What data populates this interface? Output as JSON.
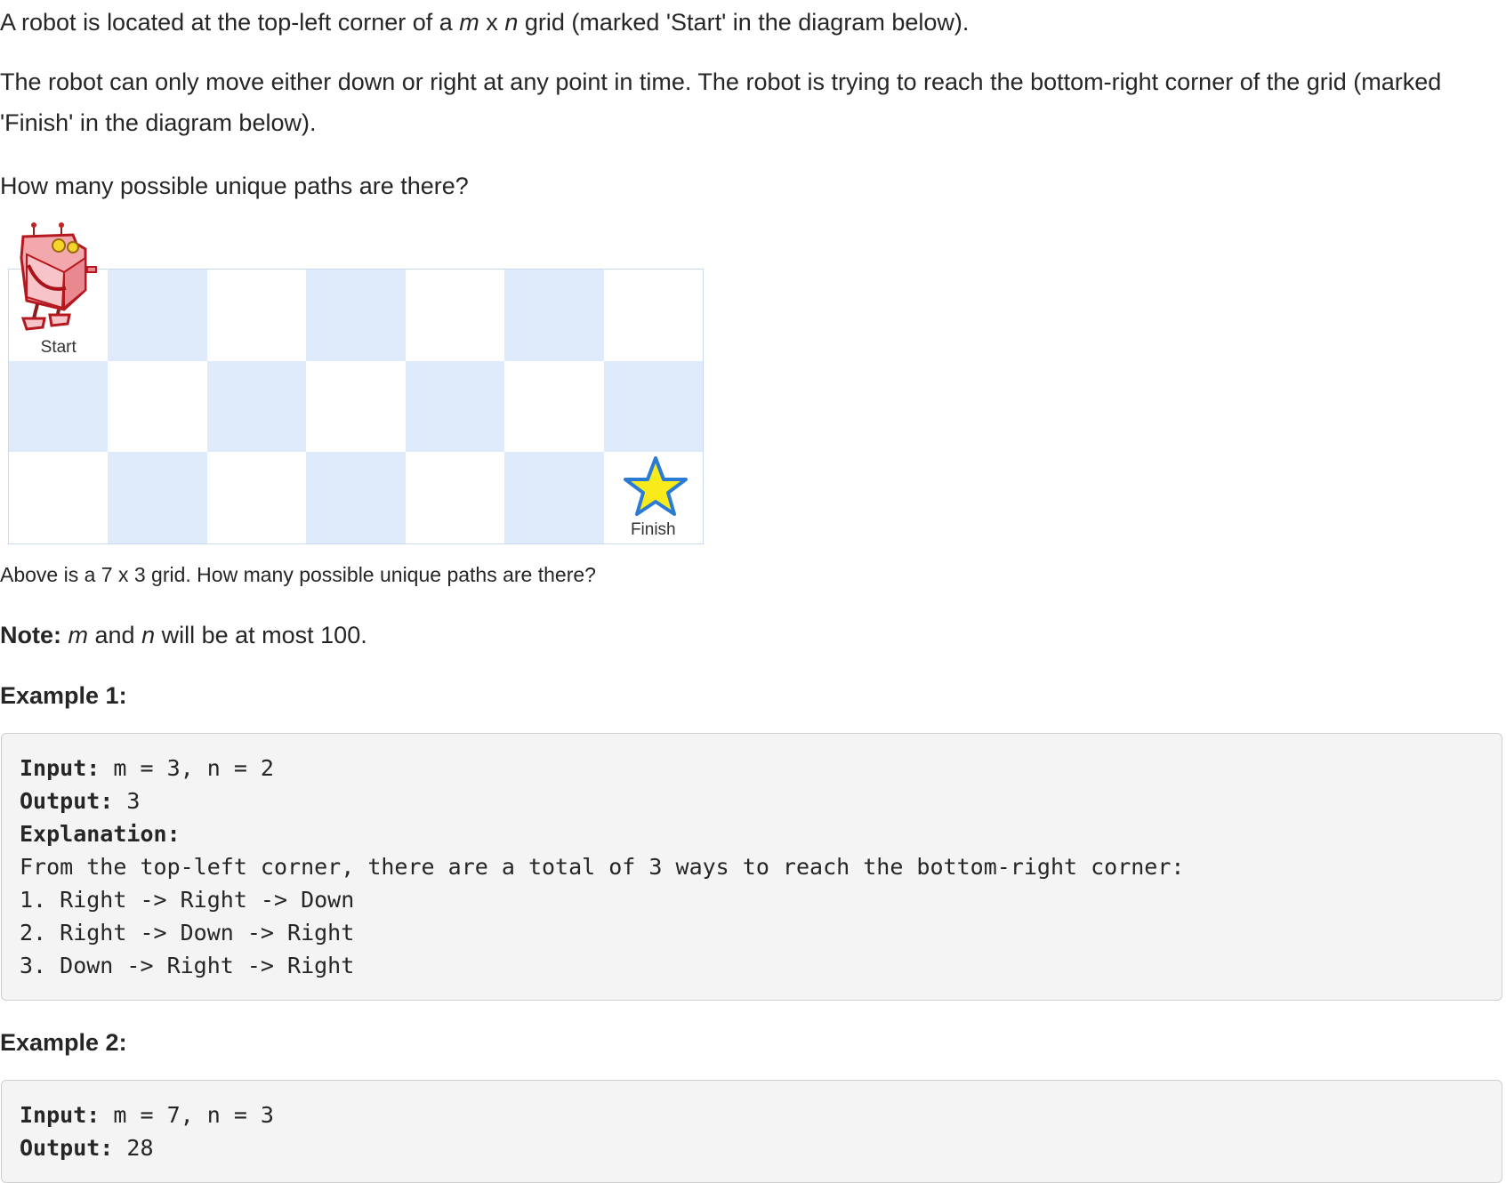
{
  "intro": {
    "line1_before": "A robot is located at the top-left corner of a ",
    "var_m": "m",
    "times": " x ",
    "var_n": "n",
    "line1_after": " grid (marked 'Start' in the diagram below).",
    "line2": "The robot can only move either down or right at any point in time. The robot is trying to reach the bottom-right corner of the grid (marked 'Finish' in the diagram below).",
    "line3": "How many possible unique paths are there?"
  },
  "figure": {
    "columns": 7,
    "rows": 3,
    "start_label": "Start",
    "finish_label": "Finish",
    "shade_color": "#dfeafb",
    "star_color": "#f9ea1c",
    "star_outline": "#2b7bd6",
    "robot_color": "#e23a3a",
    "robot_icon": "robot-icon",
    "finish_icon": "star-icon"
  },
  "caption": "Above is a 7 x 3 grid. How many possible unique paths are there?",
  "note": {
    "label": "Note:",
    "var_m": "m",
    "and": " and ",
    "var_n": "n",
    "rest": " will be at most 100."
  },
  "example1": {
    "heading": "Example 1:",
    "input_label": "Input:",
    "input_value": " m = 3, n = 2",
    "output_label": "Output:",
    "output_value": " 3",
    "explanation_label": "Explanation:",
    "lines": [
      "From the top-left corner, there are a total of 3 ways to reach the bottom-right corner:",
      "1. Right -> Right -> Down",
      "2. Right -> Down -> Right",
      "3. Down -> Right -> Right"
    ]
  },
  "example2": {
    "heading": "Example 2:",
    "input_label": "Input:",
    "input_value": " m = 7, n = 3",
    "output_label": "Output:",
    "output_value": " 28"
  }
}
